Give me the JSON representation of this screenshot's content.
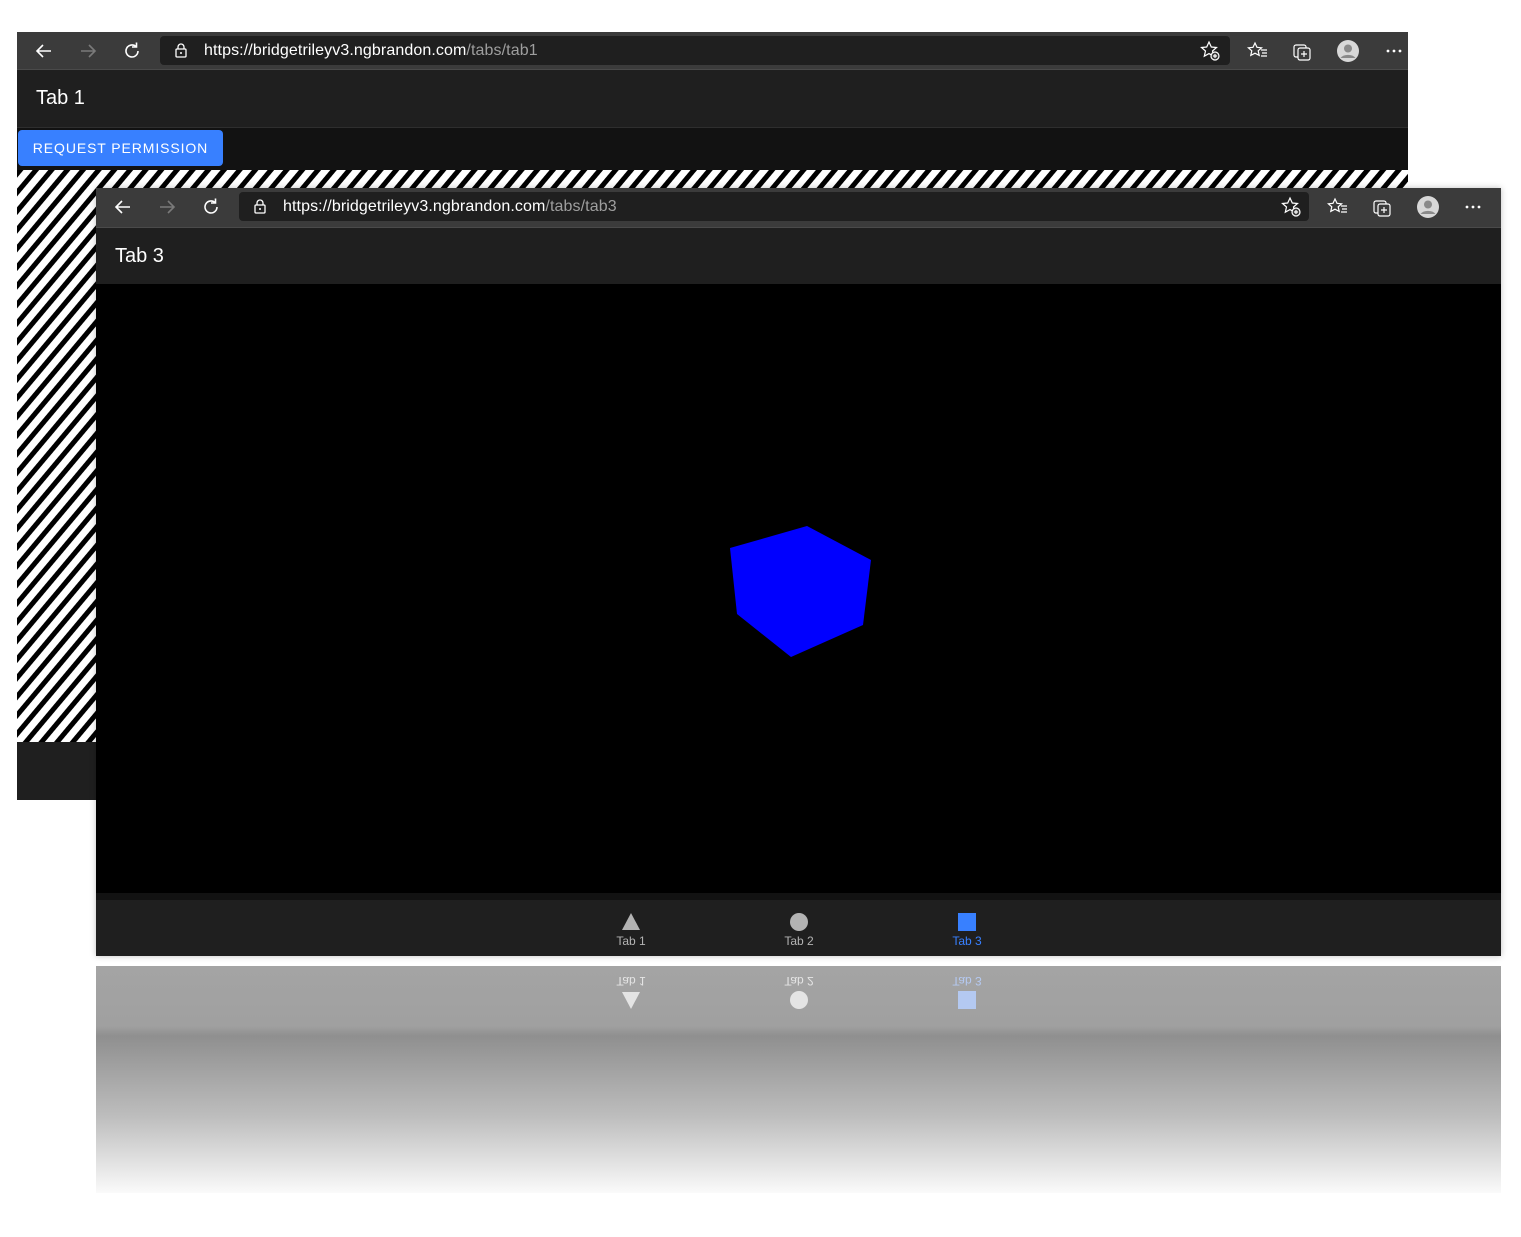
{
  "back_window": {
    "url_host": "https://bridgetrileyv3.ngbrandon.com",
    "url_path": "/tabs/tab1",
    "title": "Tab 1",
    "request_button": "REQUEST PERMISSION"
  },
  "front_window": {
    "url_host": "https://bridgetrileyv3.ngbrandon.com",
    "url_path": "/tabs/tab3",
    "title": "Tab 3",
    "cube_color": "#0000ff"
  },
  "tabs": [
    {
      "label": "Tab 1",
      "icon": "triangle-icon"
    },
    {
      "label": "Tab 2",
      "icon": "circle-icon"
    },
    {
      "label": "Tab 3",
      "icon": "square-icon",
      "active": true
    }
  ],
  "colors": {
    "accent": "#3880ff",
    "toolbar": "#3b3b3b",
    "header": "#1f1f1f"
  }
}
